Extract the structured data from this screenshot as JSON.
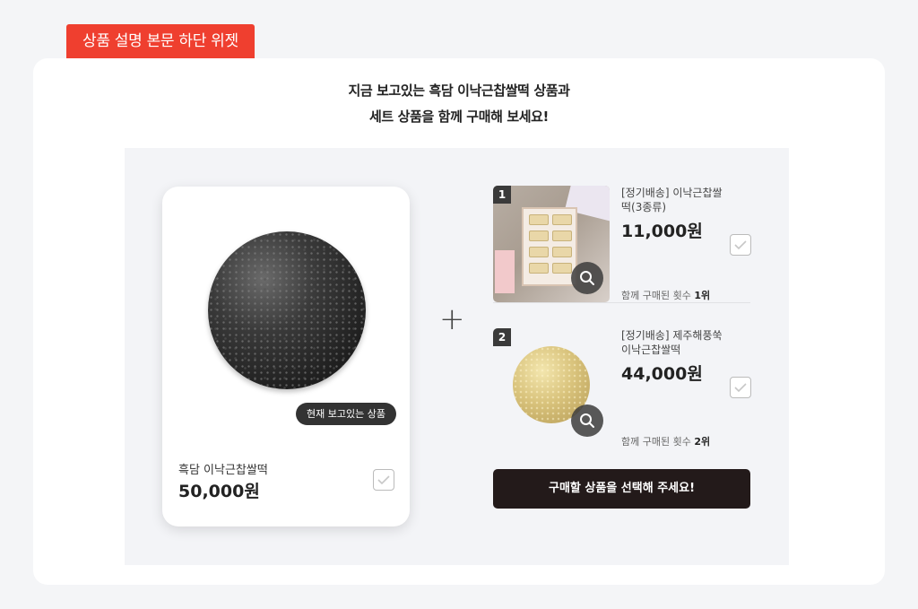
{
  "widget_tag": "상품 설명 본문 하단 위젯",
  "headline": {
    "line1": "지금 보고있는 흑담 이낙근찹쌀떡 상품과",
    "line2": "세트 상품을 함께 구매해 보세요!"
  },
  "current_product": {
    "badge": "현재 보고있는 상품",
    "name": "흑담 이낙근찹쌀떡",
    "price": "50,000원",
    "checked": false
  },
  "plus_symbol": "+",
  "recommendations": [
    {
      "rank_num": "1",
      "name": "[정기배송] 이낙근찹쌀떡(3종류)",
      "price": "11,000원",
      "rank_label": "함께 구매된 횟수",
      "rank_value": "1위",
      "checked": false
    },
    {
      "rank_num": "2",
      "name": "[정기배송] 제주해풍쑥 이낙근찹쌀떡",
      "price": "44,000원",
      "rank_label": "함께 구매된 횟수",
      "rank_value": "2위",
      "checked": false
    }
  ],
  "cta_label": "구매할 상품을 선택해 주세요!",
  "colors": {
    "tag_bg": "#ef3f2f",
    "cta_bg": "#231a1a",
    "panel_bg": "#f3f4f7"
  }
}
